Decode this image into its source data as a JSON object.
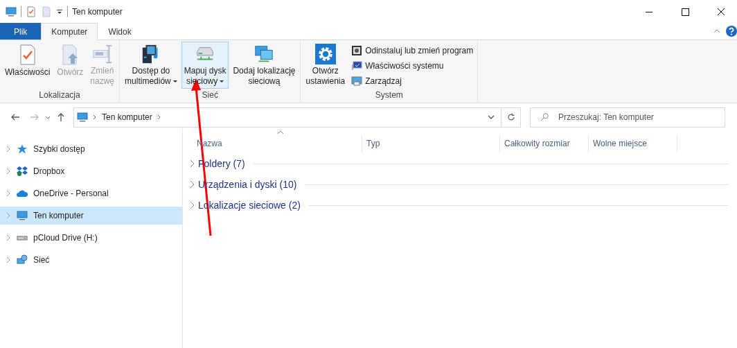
{
  "title_bar": {
    "title": "Ten komputer"
  },
  "ribbon_tabs": [
    {
      "label": "Plik",
      "kind": "file",
      "selected": false
    },
    {
      "label": "Komputer",
      "kind": "tab",
      "selected": true
    },
    {
      "label": "Widok",
      "kind": "tab",
      "selected": false
    }
  ],
  "ribbon_groups": [
    {
      "label": "Lokalizacja",
      "buttons": [
        {
          "kind": "large",
          "lines": [
            "Właściwości"
          ],
          "dropdown": false,
          "disabled": false,
          "highlighted": false
        },
        {
          "kind": "large",
          "lines": [
            "Otwórz"
          ],
          "dropdown": false,
          "disabled": true,
          "highlighted": false
        },
        {
          "kind": "large",
          "lines": [
            "Zmień",
            "nazwę"
          ],
          "dropdown": false,
          "disabled": true,
          "highlighted": false
        }
      ]
    },
    {
      "label": "Sieć",
      "buttons": [
        {
          "kind": "large",
          "lines": [
            "Dostęp do",
            "multimediów"
          ],
          "dropdown": true,
          "disabled": false,
          "highlighted": false
        },
        {
          "kind": "large",
          "lines": [
            "Mapuj dysk",
            "sieciowy"
          ],
          "dropdown": true,
          "disabled": false,
          "highlighted": true
        },
        {
          "kind": "large",
          "lines": [
            "Dodaj lokalizację",
            "sieciową"
          ],
          "dropdown": false,
          "disabled": false,
          "highlighted": false
        }
      ]
    },
    {
      "label": "System",
      "buttons": [
        {
          "kind": "large",
          "lines": [
            "Otwórz",
            "ustawienia"
          ],
          "dropdown": false,
          "disabled": false,
          "highlighted": false
        },
        {
          "kind": "small",
          "lines": [
            "Odinstaluj lub zmień program"
          ],
          "dropdown": false,
          "disabled": false,
          "highlighted": false
        },
        {
          "kind": "small",
          "lines": [
            "Właściwości systemu"
          ],
          "dropdown": false,
          "disabled": false,
          "highlighted": false
        },
        {
          "kind": "small",
          "lines": [
            "Zarządzaj"
          ],
          "dropdown": false,
          "disabled": false,
          "highlighted": false
        }
      ]
    }
  ],
  "address_bar": {
    "path": [
      "Ten komputer"
    ]
  },
  "search": {
    "placeholder": "Przeszukaj: Ten komputer"
  },
  "sidebar": {
    "items": [
      {
        "label": "Szybki dostęp",
        "selected": false
      },
      {
        "label": "Dropbox",
        "selected": false
      },
      {
        "label": "OneDrive - Personal",
        "selected": false
      },
      {
        "label": "Ten komputer",
        "selected": true
      },
      {
        "label": "pCloud Drive (H:)",
        "selected": false
      },
      {
        "label": "Sieć",
        "selected": false
      }
    ]
  },
  "table": {
    "columns": [
      "Nazwa",
      "Typ",
      "Całkowity rozmiar",
      "Wolne miejsce"
    ]
  },
  "groups": [
    {
      "label": "Foldery (7)",
      "expanded": false
    },
    {
      "label": "Urządzenia i dyski (10)",
      "expanded": false
    },
    {
      "label": "Lokalizacje sieciowe (2)",
      "expanded": false
    }
  ]
}
